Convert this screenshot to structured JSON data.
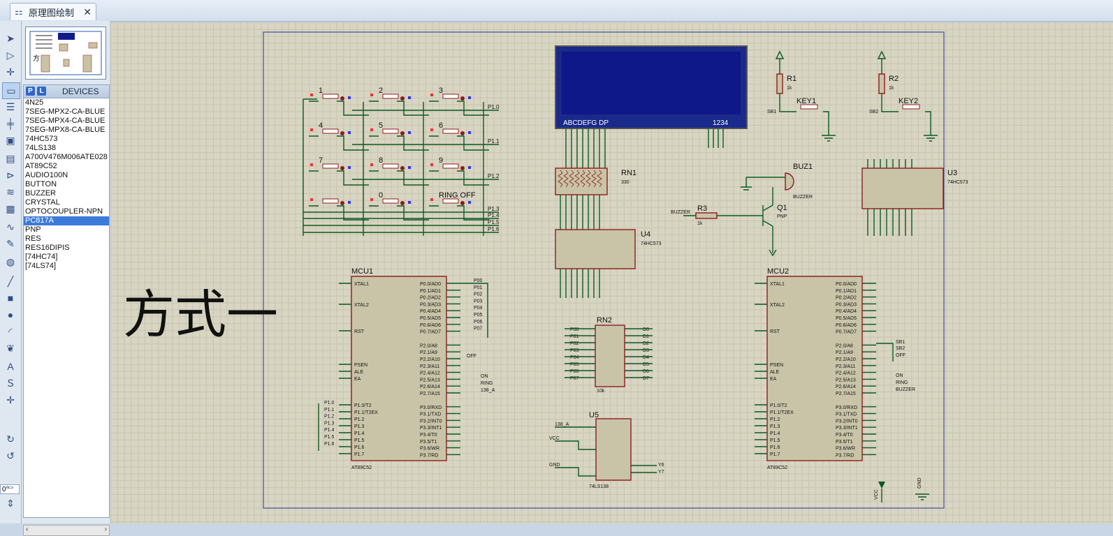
{
  "tab": {
    "title": "原理图绘制",
    "close": "✕"
  },
  "devices": {
    "p_label": "P",
    "l_label": "L",
    "header": "DEVICES",
    "items": [
      "4N25",
      "7SEG-MPX2-CA-BLUE",
      "7SEG-MPX4-CA-BLUE",
      "7SEG-MPX8-CA-BLUE",
      "74HC573",
      "74LS138",
      "A700V476M006ATE028",
      "AT89C52",
      "AUDIO100N",
      "BUTTON",
      "BUZZER",
      "CRYSTAL",
      "OPTOCOUPLER-NPN",
      "PC817A",
      "PNP",
      "RES",
      "RES16DIPIS",
      "[74HC74]",
      "[74LS74]"
    ],
    "selected_index": 13
  },
  "rotation": "0°",
  "canvas": {
    "big_text": "方式一",
    "keys": [
      "1",
      "2",
      "3",
      "4",
      "5",
      "6",
      "7",
      "8",
      "9",
      "0",
      "RING OFF"
    ],
    "port_labels": [
      "P1.0",
      "P1.1",
      "P1.2",
      "P1.3",
      "P1.4",
      "P1.5",
      "P1.6"
    ],
    "lcd": {
      "segments": "ABCDEFG DP",
      "digits": "1234"
    },
    "rn1": {
      "name": "RN1",
      "value": "330"
    },
    "rn2": {
      "name": "RN2",
      "value": "10k"
    },
    "u4": {
      "name": "U4",
      "part": "74HC573"
    },
    "u3": {
      "name": "U3",
      "part": "74HC573"
    },
    "u5": {
      "name": "U5",
      "part": "74LS138"
    },
    "r1": {
      "name": "R1",
      "value": "1k"
    },
    "r2": {
      "name": "R2",
      "value": "1k"
    },
    "r3": {
      "name": "R3",
      "value": "1k"
    },
    "key1": "KEY1",
    "key2": "KEY2",
    "sb1": "SB1",
    "sb2": "SB2",
    "buz": {
      "name": "BUZ1",
      "part": "BUZZER"
    },
    "q1": {
      "name": "Q1",
      "part": "PNP"
    },
    "buzzer_net": "BUZZER",
    "mcu1": {
      "name": "MCU1",
      "part": "AT89C52"
    },
    "mcu2": {
      "name": "MCU2",
      "part": "AT89C52"
    },
    "mcu_left_pins": [
      "XTAL1",
      "XTAL2",
      "RST",
      "PSEN",
      "ALE",
      "EA",
      "P1.0/T2",
      "P1.1/T2EX",
      "P1.2",
      "P1.3",
      "P1.4",
      "P1.5",
      "P1.6",
      "P1.7"
    ],
    "mcu_right_pins": [
      "P0.0/AD0",
      "P0.1/AD1",
      "P0.2/AD2",
      "P0.3/AD3",
      "P0.4/AD4",
      "P0.5/AD5",
      "P0.6/AD6",
      "P0.7/AD7",
      "P2.0/A8",
      "P2.1/A9",
      "P2.2/A10",
      "P2.3/A11",
      "P2.4/A12",
      "P2.5/A13",
      "P2.6/A14",
      "P2.7/A15",
      "P3.0/RXD",
      "P3.1/TXD",
      "P3.2/INT0",
      "P3.3/INT1",
      "P3.4/T0",
      "P3.5/T1",
      "P3.6/WR",
      "P3.7/RD"
    ],
    "mcu1_nets": [
      "P00",
      "P01",
      "P02",
      "P03",
      "P04",
      "P05",
      "P06",
      "P07",
      "OFF",
      "ON",
      "RING",
      "138_A"
    ],
    "mcu2_nets": [
      "SB1",
      "SB2",
      "OFF",
      "ON",
      "RING",
      "BUZZER"
    ],
    "vcc": "VCC",
    "gnd": "GND"
  }
}
